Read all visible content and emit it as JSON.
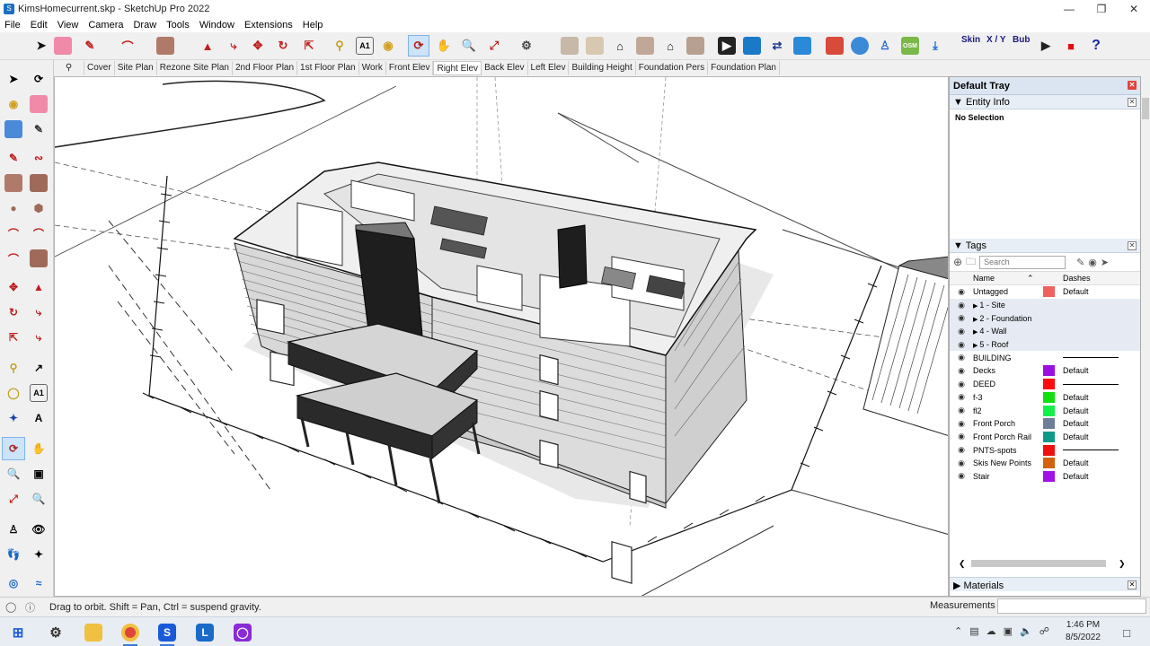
{
  "window": {
    "title": "KimsHomecurrent.skp - SketchUp Pro 2022",
    "app_icon": "sketchup-icon",
    "controls": [
      "minimize",
      "restore",
      "close"
    ]
  },
  "menu": [
    "File",
    "Edit",
    "View",
    "Camera",
    "Draw",
    "Tools",
    "Window",
    "Extensions",
    "Help"
  ],
  "toolbar": {
    "extension_labels": [
      "Skin",
      "X / Y",
      "Bub"
    ],
    "icons": [
      "select-icon",
      "eraser-icon",
      "pencil-icon",
      "arc-icon",
      "paint-icon",
      "push-pull-icon",
      "follow-me-icon",
      "move-icon",
      "rotate-icon",
      "scale-icon",
      "tape-icon",
      "text-icon",
      "paint-bucket-icon",
      "orbit-icon",
      "pan-icon",
      "zoom-icon",
      "zoom-extents-icon",
      "styles-icon",
      "iso-icon",
      "front-view-icon",
      "home-icon",
      "back-view-icon",
      "left-view-icon",
      "right-view-icon",
      "scenes-icon",
      "display-icon",
      "section-icon",
      "solid-icon",
      "shield-icon",
      "geo-icon",
      "person-icon",
      "osm-icon",
      "download-icon"
    ]
  },
  "scenes": {
    "search_icon": "search-icon",
    "tabs": [
      "Cover",
      "Site Plan",
      "Rezone Site Plan",
      "2nd Floor Plan",
      "1st Floor Plan",
      "Work",
      "Front Elev",
      "Right Elev",
      "Back Elev",
      "Left Elev",
      "Building Height",
      "Foundation Pers",
      "Foundation Plan"
    ],
    "selected": "Right Elev"
  },
  "tray": {
    "title": "Default Tray",
    "entity_info": {
      "title": "Entity Info",
      "status": "No Selection"
    },
    "tags": {
      "title": "Tags",
      "search_placeholder": "Search",
      "col_name": "Name",
      "col_dashes": "Dashes",
      "rows": [
        {
          "name": "Untagged",
          "color": "#f06262",
          "dashes": "Default",
          "group": false
        },
        {
          "name": "1 - Site",
          "color": "",
          "dashes": "",
          "group": true
        },
        {
          "name": "2 - Foundation",
          "color": "",
          "dashes": "",
          "group": true
        },
        {
          "name": "4 - Wall",
          "color": "",
          "dashes": "",
          "group": true
        },
        {
          "name": "5 - Roof",
          "color": "",
          "dashes": "",
          "group": true
        },
        {
          "name": "BUILDING",
          "color": "",
          "dashes": "line",
          "group": false
        },
        {
          "name": "Decks",
          "color": "#9b10e0",
          "dashes": "Default",
          "group": false
        },
        {
          "name": "DEED",
          "color": "#ff0b0b",
          "dashes": "line",
          "group": false
        },
        {
          "name": "f-3",
          "color": "#10e010",
          "dashes": "Default",
          "group": false
        },
        {
          "name": "fl2",
          "color": "#12f04a",
          "dashes": "Default",
          "group": false
        },
        {
          "name": "Front Porch",
          "color": "#6e7e97",
          "dashes": "Default",
          "group": false
        },
        {
          "name": "Front Porch Rail",
          "color": "#0e9a8a",
          "dashes": "Default",
          "group": false
        },
        {
          "name": "PNTS-spots",
          "color": "#f01010",
          "dashes": "line",
          "group": false
        },
        {
          "name": "Skis New Points",
          "color": "#d2620e",
          "dashes": "Default",
          "group": false
        },
        {
          "name": "Stair",
          "color": "#a212e6",
          "dashes": "Default",
          "group": false
        }
      ]
    },
    "materials_title": "Materials"
  },
  "status": {
    "hint": "Drag to orbit. Shift = Pan, Ctrl = suspend gravity.",
    "measurements_label": "Measurements",
    "measurements_value": ""
  },
  "taskbar": {
    "time": "1:46 PM",
    "date": "8/5/2022"
  }
}
